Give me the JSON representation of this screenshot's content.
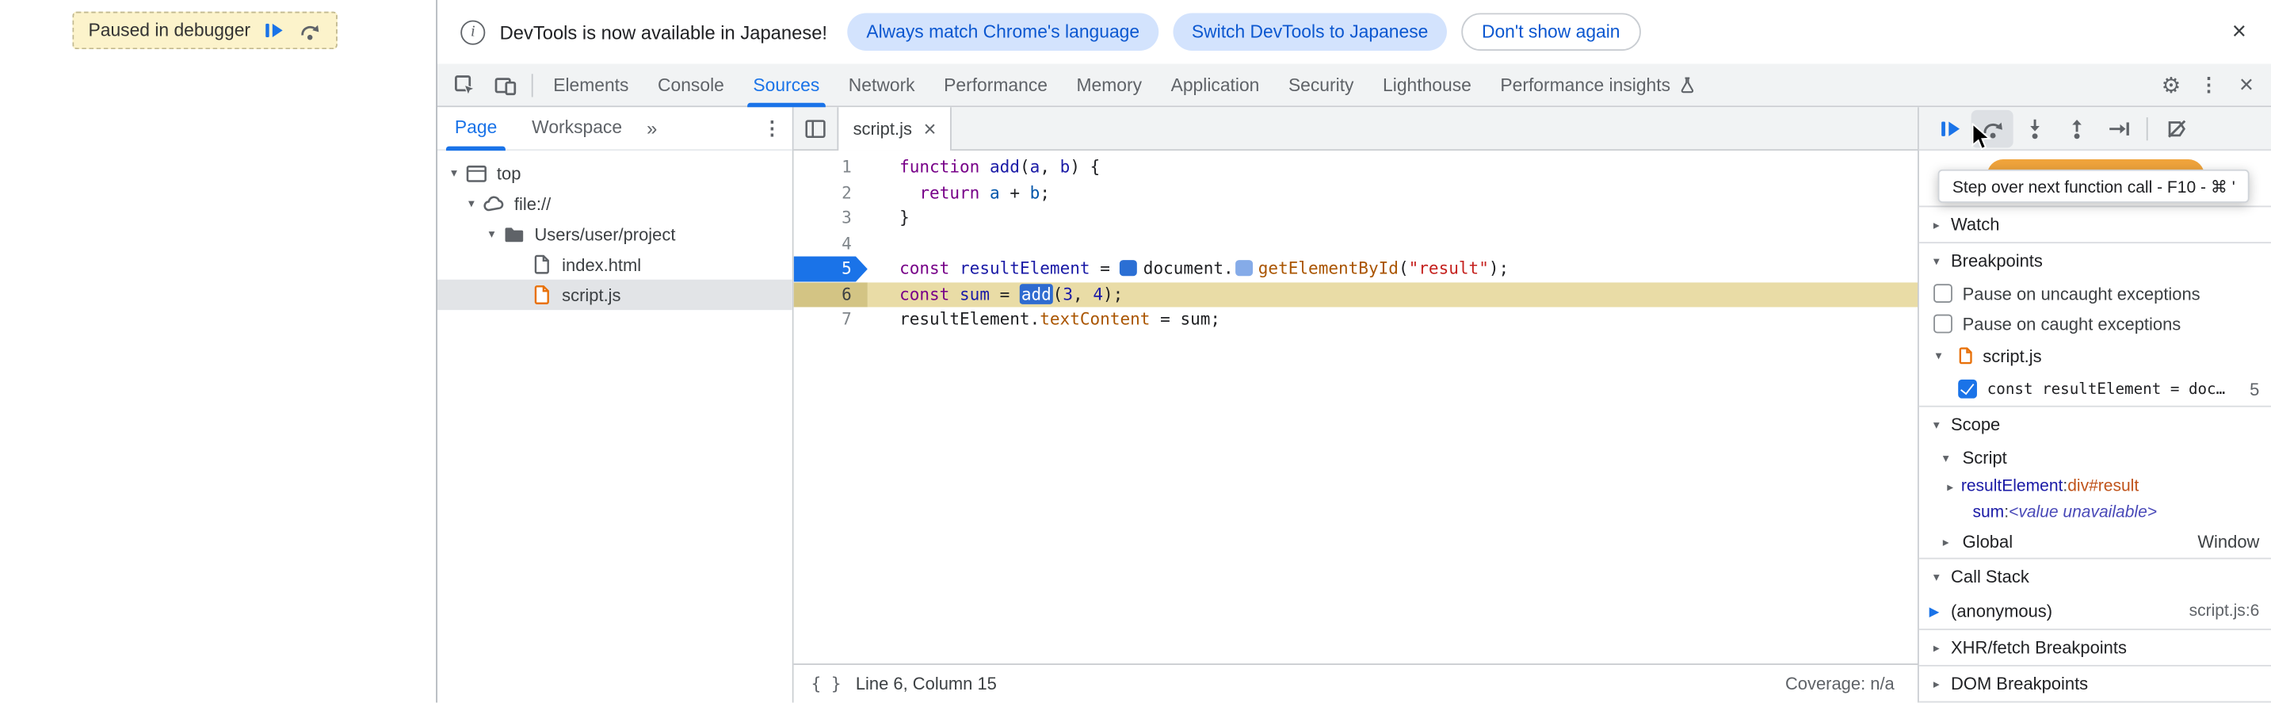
{
  "colors": {
    "accent": "#1a73e8",
    "paused_line_bg": "#e9dca6",
    "breakpoint_flag": "#1a73e8",
    "paused_message_orange": "#f0a43c",
    "tonal_button_bg": "#d3e3fd",
    "tonal_button_text": "#0b57d0",
    "script_file_icon": "#e8710a"
  },
  "icons": {
    "close": "×",
    "menu": "⋮",
    "settings": "⚙",
    "more_tabs": "»",
    "expanded": "▾",
    "collapsed": "▸",
    "frame_marker": "▶",
    "braces": "{ }",
    "info": "i"
  },
  "page": {
    "paused_banner": "Paused in debugger"
  },
  "notification": {
    "message": "DevTools is now available in Japanese!",
    "primary_button": "Always match Chrome's language",
    "secondary_button": "Switch DevTools to Japanese",
    "dismiss_button": "Don't show again"
  },
  "toolbar": {
    "tabs": [
      "Elements",
      "Console",
      "Sources",
      "Network",
      "Performance",
      "Memory",
      "Application",
      "Security",
      "Lighthouse",
      "Performance insights"
    ],
    "selected_tab": "Sources"
  },
  "navigator": {
    "tabs": [
      "Page",
      "Workspace"
    ],
    "selected_tab": "Page",
    "tree": [
      {
        "label": "top",
        "icon": "frame-icon"
      },
      {
        "label": "file://",
        "icon": "cloud-icon"
      },
      {
        "label": "Users/user/project",
        "icon": "folder-icon"
      },
      {
        "label": "index.html",
        "icon": "document-icon"
      },
      {
        "label": "script.js",
        "icon": "script-icon",
        "selected": true
      }
    ]
  },
  "editor": {
    "tab_label": "script.js",
    "status_left": "Line 6, Column 15",
    "status_right": "Coverage: n/a",
    "lines": [
      {
        "num": 1,
        "tokens": [
          [
            "kw",
            "function"
          ],
          [
            "pl",
            " "
          ],
          [
            "def",
            "add"
          ],
          [
            "pl",
            "("
          ],
          [
            "def",
            "a"
          ],
          [
            "pl",
            ", "
          ],
          [
            "def",
            "b"
          ],
          [
            "pl",
            ") {"
          ]
        ]
      },
      {
        "num": 2,
        "tokens": [
          [
            "pl",
            "  "
          ],
          [
            "kw",
            "return"
          ],
          [
            "pl",
            " "
          ],
          [
            "lv",
            "a"
          ],
          [
            "pl",
            " + "
          ],
          [
            "lv",
            "b"
          ],
          [
            "pl",
            ";"
          ]
        ]
      },
      {
        "num": 3,
        "tokens": [
          [
            "pl",
            "}"
          ]
        ]
      },
      {
        "num": 4,
        "tokens": []
      },
      {
        "num": 5,
        "breakpoint": true,
        "tokens": [
          [
            "kw",
            "const"
          ],
          [
            "pl",
            " "
          ],
          [
            "def",
            "resultElement"
          ],
          [
            "pl",
            " = "
          ],
          [
            "bp1",
            ""
          ],
          [
            "pl",
            "document."
          ],
          [
            "bp2",
            ""
          ],
          [
            "prop",
            "getElementById"
          ],
          [
            "pl",
            "("
          ],
          [
            "str",
            "\"result\""
          ],
          [
            "pl",
            ");"
          ]
        ]
      },
      {
        "num": 6,
        "paused": true,
        "tokens": [
          [
            "kw",
            "const"
          ],
          [
            "pl",
            " "
          ],
          [
            "def",
            "sum"
          ],
          [
            "pl",
            " = "
          ],
          [
            "sel",
            "add"
          ],
          [
            "pl",
            "("
          ],
          [
            "num",
            "3"
          ],
          [
            "pl",
            ", "
          ],
          [
            "num",
            "4"
          ],
          [
            "pl",
            ");"
          ]
        ]
      },
      {
        "num": 7,
        "tokens": [
          [
            "pl",
            "resultElement."
          ],
          [
            "prop",
            "textContent"
          ],
          [
            "pl",
            " = sum;"
          ]
        ]
      }
    ]
  },
  "debugger": {
    "tooltip": "Step over next function call - F10 - ⌘ '",
    "sections": {
      "watch": "Watch",
      "breakpoints": "Breakpoints",
      "scope": "Scope",
      "call_stack": "Call Stack",
      "xhr": "XHR/fetch Breakpoints",
      "dom": "DOM Breakpoints"
    },
    "breakpoints": {
      "pause_uncaught": "Pause on uncaught exceptions",
      "pause_caught": "Pause on caught exceptions",
      "file": "script.js",
      "entry_code": "const resultElement = doc…",
      "entry_line": "5"
    },
    "scope": {
      "script_group": "Script",
      "vars": [
        {
          "name": "resultElement",
          "value": "div#result"
        },
        {
          "name": "sum",
          "value": "<value unavailable>"
        }
      ],
      "global_group": "Global",
      "global_value": "Window"
    },
    "call_stack": {
      "frame": "(anonymous)",
      "location": "script.js:6"
    }
  }
}
